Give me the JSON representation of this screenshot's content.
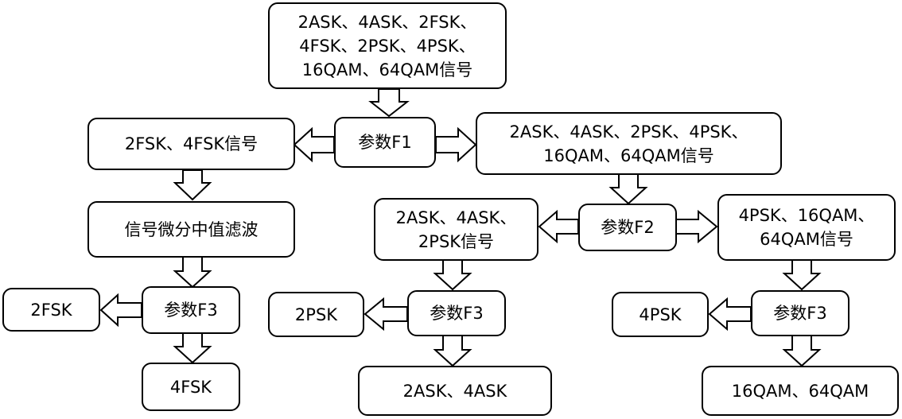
{
  "nodes": {
    "input_signals": "2ASK、4ASK、2FSK、\n4FSK、2PSK、4PSK、\n16QAM、64QAM信号",
    "param_f1": "参数F1",
    "fsk_group": "2FSK、4FSK信号",
    "other_group": "2ASK、4ASK、2PSK、4PSK、\n16QAM、64QAM信号",
    "filter": "信号微分中值滤波",
    "param_f3_left": "参数F3",
    "out_2fsk": "2FSK",
    "out_4fsk": "4FSK",
    "ask_psk_group": "2ASK、4ASK、\n2PSK信号",
    "param_f2": "参数F2",
    "psk_qam_group": "4PSK、16QAM、\n64QAM信号",
    "param_f3_mid": "参数F3",
    "out_2psk": "2PSK",
    "out_2ask_4ask": "2ASK、4ASK",
    "param_f3_right": "参数F3",
    "out_4psk": "4PSK",
    "out_16qam_64qam": "16QAM、64QAM"
  }
}
